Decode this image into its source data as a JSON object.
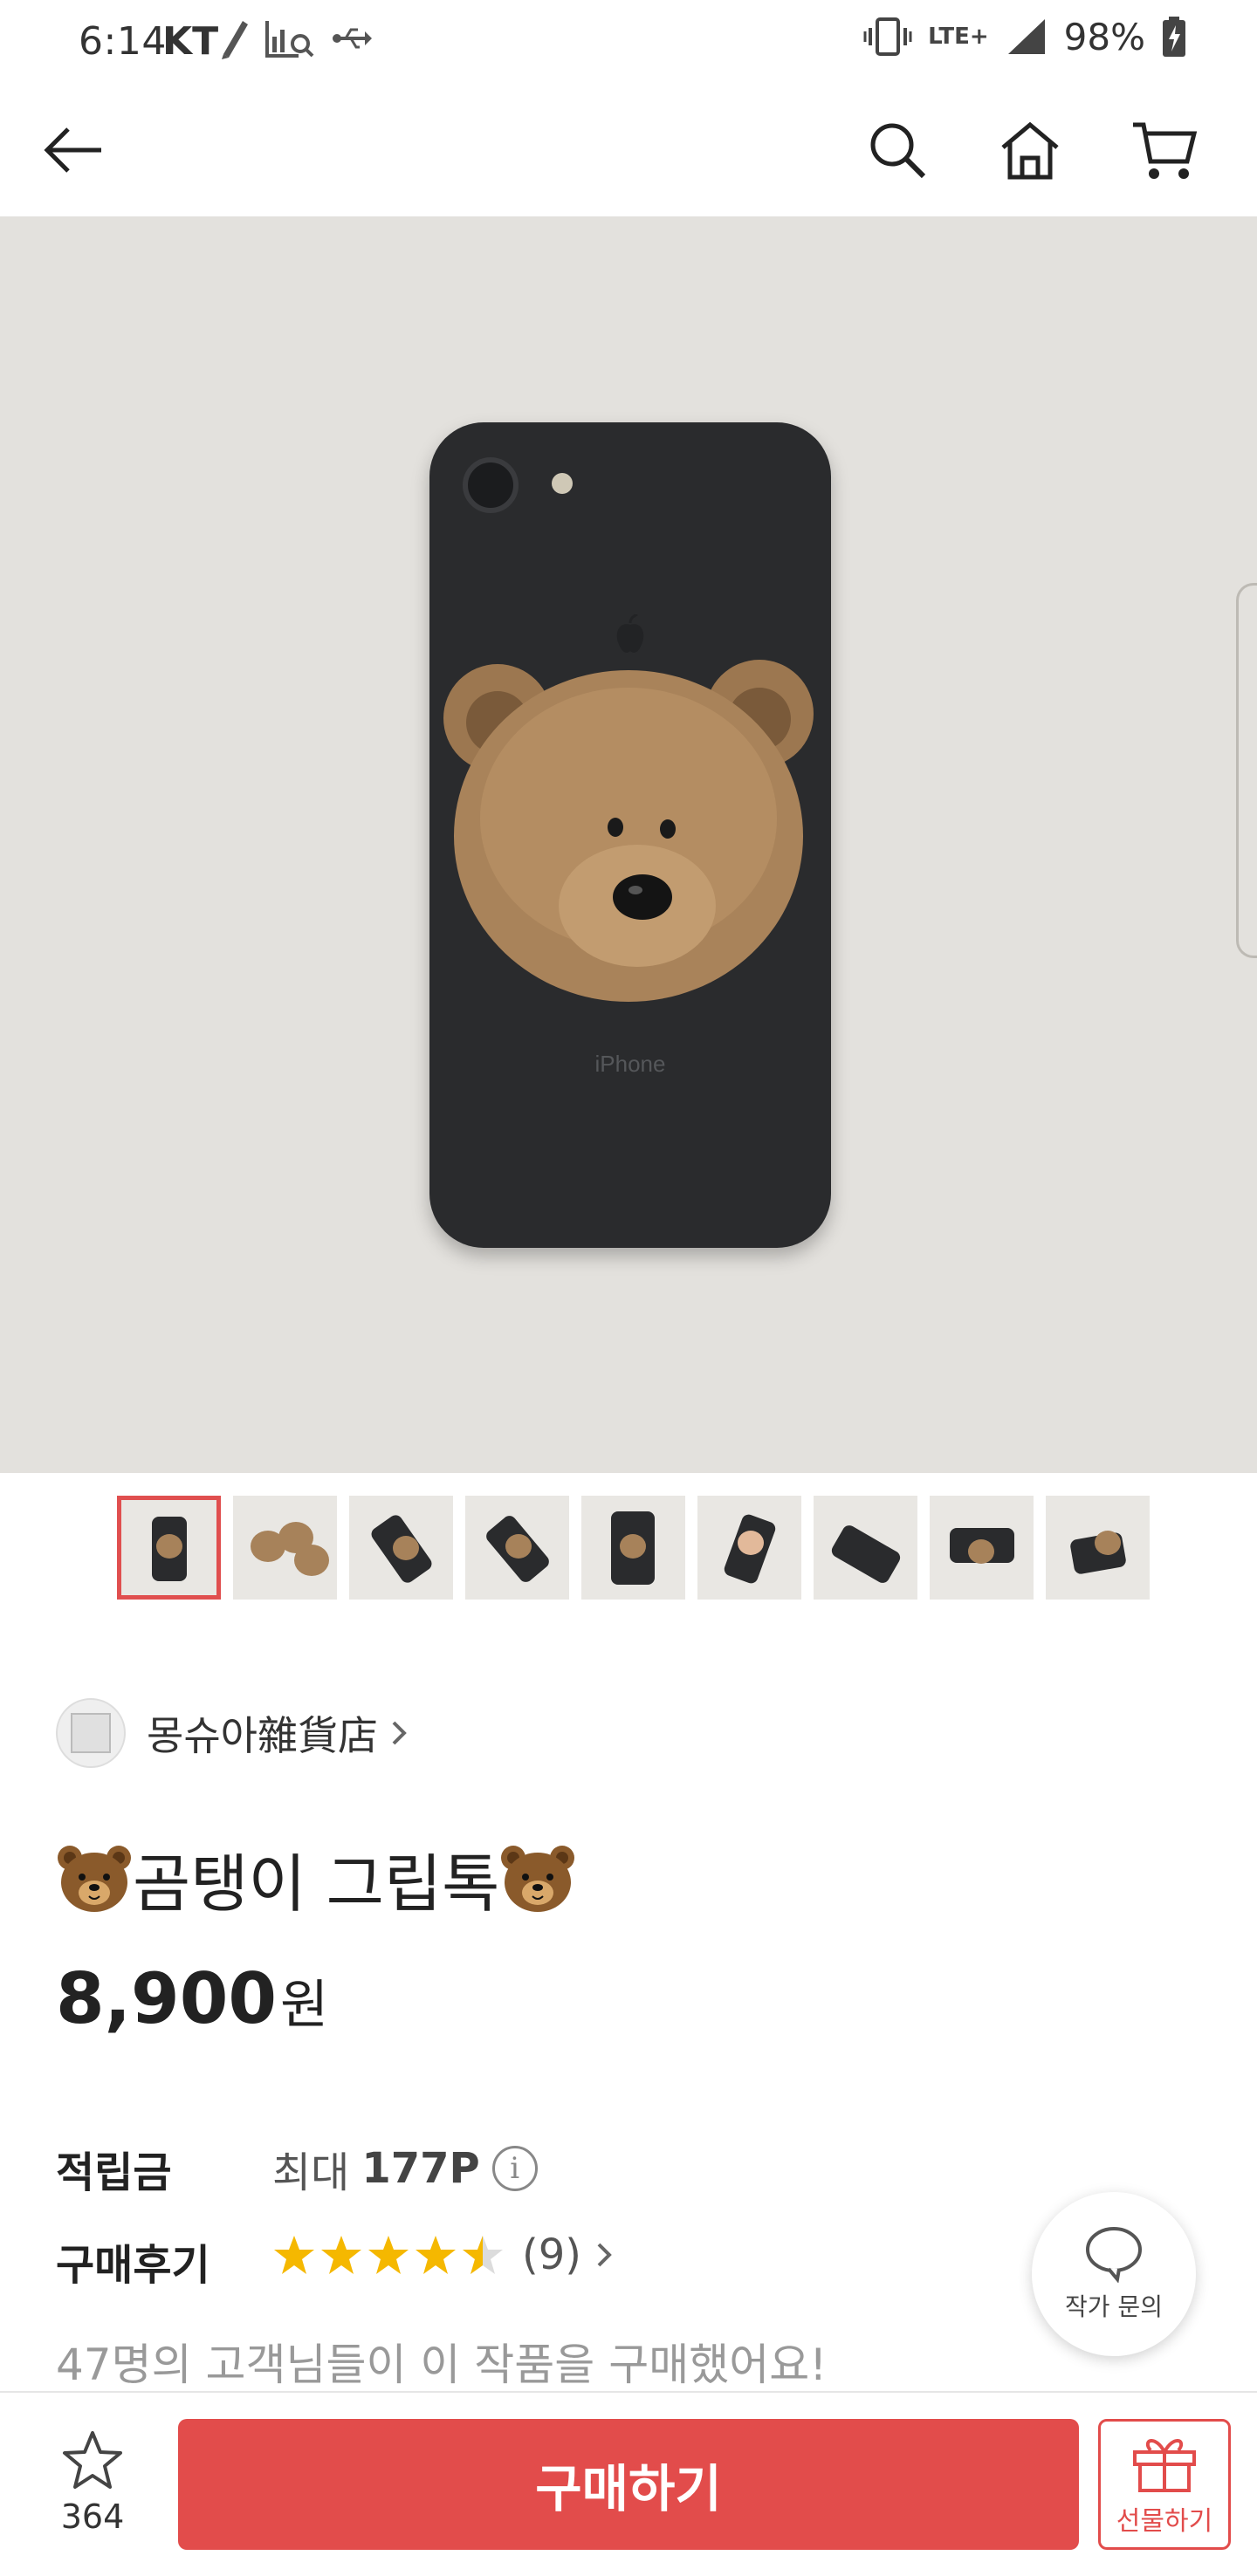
{
  "status_bar": {
    "time": "6:14",
    "carrier": "KT",
    "network": "LTE+",
    "battery": "98%"
  },
  "header": {
    "back_icon": "arrow-left-icon",
    "search_icon": "search-icon",
    "home_icon": "home-icon",
    "cart_icon": "cart-icon"
  },
  "product_image": {
    "phone_label": "iPhone",
    "thumbnail_count": 9,
    "selected_thumbnail": 1
  },
  "shop": {
    "name": "몽슈아雜貨店"
  },
  "product": {
    "title": "곰탱이 그립톡",
    "price": "8,900",
    "price_unit": "원"
  },
  "info": {
    "points_label": "적립금",
    "points_prefix": "최대",
    "points_value": "177P",
    "review_label": "구매후기",
    "rating": 4.5,
    "review_count": "(9)",
    "buyers_text": "47명의 고객님들이 이 작품을 구매했어요!"
  },
  "chat_fab": {
    "label": "작가 문의"
  },
  "bottom_bar": {
    "favorite_count": "364",
    "buy_label": "구매하기",
    "gift_label": "선물하기"
  },
  "colors": {
    "accent": "#e24c4b",
    "star": "#f5b800"
  }
}
